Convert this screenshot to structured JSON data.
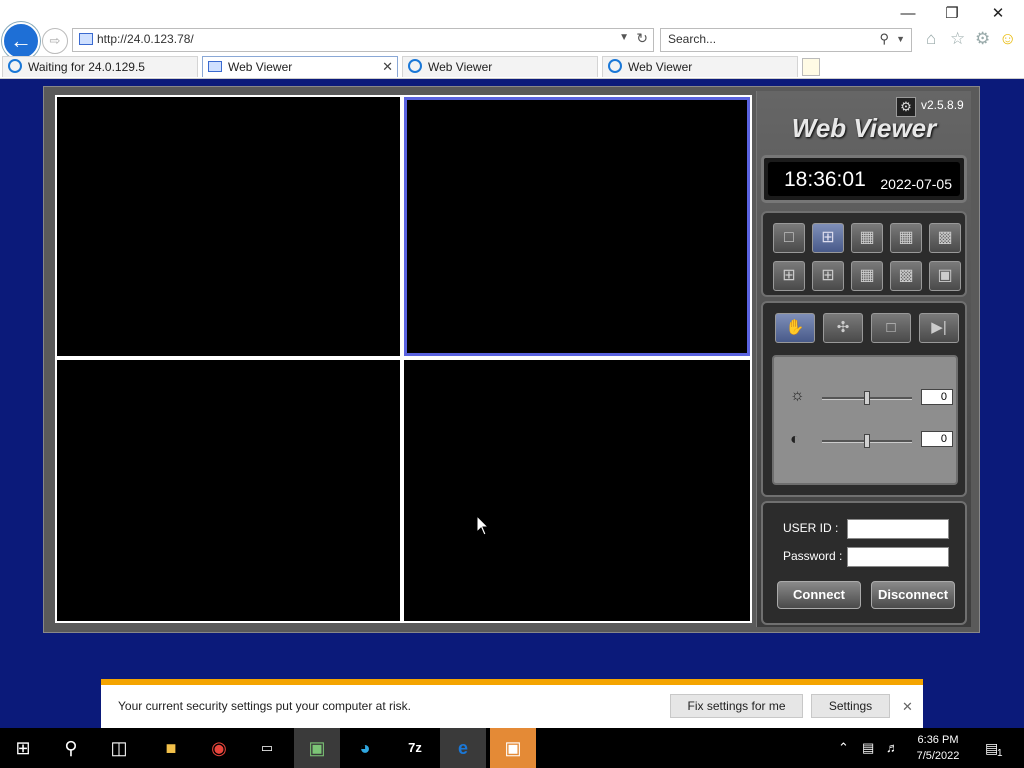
{
  "browser": {
    "url": "http://24.0.123.78/",
    "search_placeholder": "Search...",
    "tabs": [
      {
        "label": "Waiting for 24.0.129.5"
      },
      {
        "label": "Web Viewer"
      },
      {
        "label": "Web Viewer"
      },
      {
        "label": "Web Viewer"
      }
    ]
  },
  "viewer": {
    "version": "v2.5.8.9",
    "brand": "Web Viewer",
    "time": "18:36:01",
    "date": "2022-07-05",
    "brightness_value": "0",
    "contrast_value": "0",
    "brightness_level": 0.5,
    "contrast_level": 0.5,
    "user_id_label": "USER ID :",
    "password_label": "Password :",
    "user_id_value": "",
    "password_value": "",
    "connect_label": "Connect",
    "disconnect_label": "Disconnect",
    "selected_layout": "2x2"
  },
  "notification": {
    "message": "Your current security settings put your computer at risk.",
    "fix_button": "Fix settings for me",
    "settings_button": "Settings"
  },
  "taskbar": {
    "time": "6:36 PM",
    "date": "7/5/2022",
    "notification_count": "1"
  }
}
